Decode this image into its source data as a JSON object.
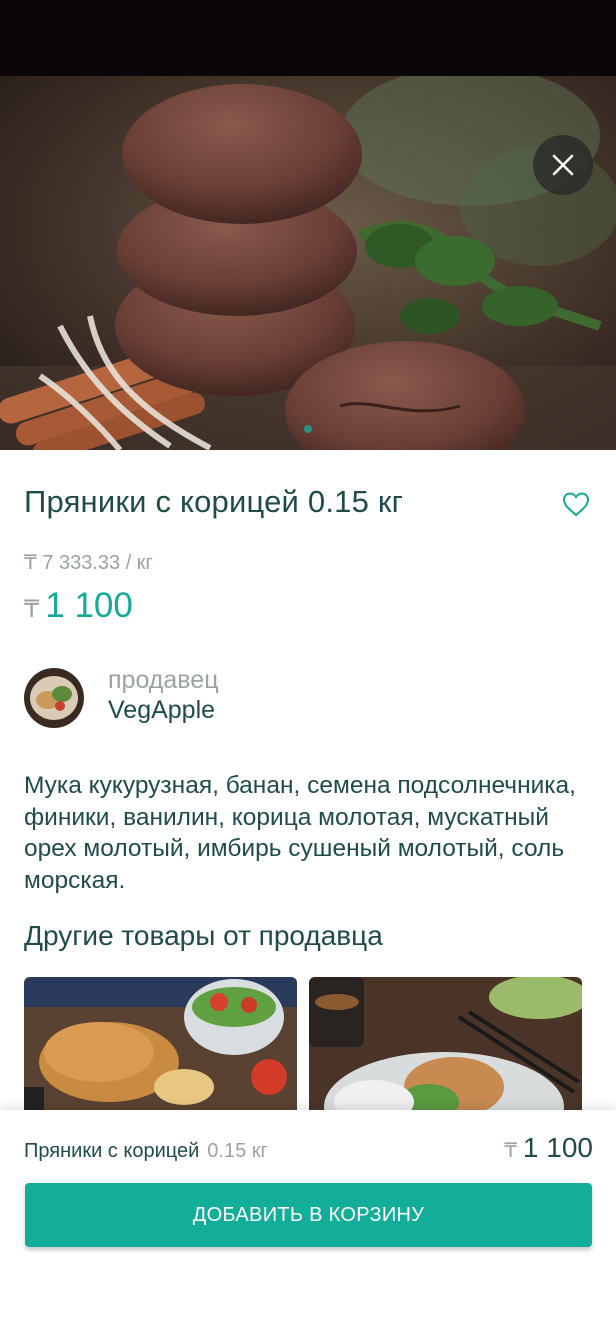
{
  "product": {
    "title": "Пряники с корицей 0.15 кг",
    "unit_price": "₸ 7 333.33 / кг",
    "currency": "₸",
    "price": "1 100"
  },
  "seller": {
    "label": "продавец",
    "name": "VegApple"
  },
  "description": "Мука кукурузная, банан, семена подсолнечника, финики, ванилин, корица молотая, мускатный орех молотый, имбирь сушеный молотый, соль морская.",
  "other_products": {
    "title": "Другие товары от продавца"
  },
  "cart_bar": {
    "name": "Пряники с корицей",
    "weight": "0.15 кг",
    "currency": "₸",
    "price": "1 100",
    "add_button": "ДОБАВИТЬ В КОРЗИНУ"
  },
  "colors": {
    "accent": "#12ae9a",
    "text_dark": "#1f4c4a",
    "text_muted": "#9aa3a3"
  },
  "icons": [
    "close-icon",
    "heart-icon"
  ]
}
